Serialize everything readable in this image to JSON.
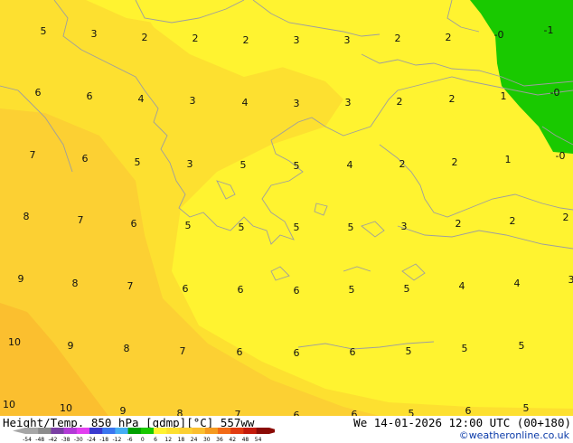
{
  "map": {
    "title": "Height/Temp. 850 hPa [gdmp][°C] 557ww",
    "datetime": "We 14-01-2026 12:00 UTC (00+180)",
    "credit": "©weatheronline.co.uk",
    "colors": {
      "warm_orange": "#fbbf2f",
      "orange": "#fcd033",
      "yellow_orange": "#fde030",
      "yellow": "#fff330",
      "green": "#19c900",
      "coastline": "#9e9e9e"
    },
    "labels": [
      [
        "5",
        48,
        38
      ],
      [
        "3",
        104,
        41
      ],
      [
        "2",
        160,
        45
      ],
      [
        "2",
        216,
        46
      ],
      [
        "2",
        272,
        48
      ],
      [
        "3",
        328,
        48
      ],
      [
        "3",
        384,
        48
      ],
      [
        "2",
        440,
        46
      ],
      [
        "2",
        496,
        45
      ],
      [
        "-0",
        552,
        42
      ],
      [
        "-1",
        607,
        37
      ],
      [
        "6",
        42,
        106
      ],
      [
        "6",
        99,
        110
      ],
      [
        "4",
        156,
        113
      ],
      [
        "3",
        213,
        115
      ],
      [
        "4",
        271,
        117
      ],
      [
        "3",
        328,
        118
      ],
      [
        "3",
        385,
        117
      ],
      [
        "2",
        442,
        116
      ],
      [
        "2",
        500,
        113
      ],
      [
        "1",
        557,
        110
      ],
      [
        "-0",
        614,
        106
      ],
      [
        "7",
        36,
        175
      ],
      [
        "6",
        94,
        179
      ],
      [
        "5",
        152,
        183
      ],
      [
        "3",
        210,
        185
      ],
      [
        "5",
        269,
        186
      ],
      [
        "5",
        328,
        187
      ],
      [
        "4",
        387,
        186
      ],
      [
        "2",
        445,
        185
      ],
      [
        "2",
        503,
        183
      ],
      [
        "1",
        562,
        180
      ],
      [
        "-0",
        620,
        176
      ],
      [
        "8",
        29,
        243
      ],
      [
        "7",
        89,
        247
      ],
      [
        "6",
        148,
        251
      ],
      [
        "5",
        208,
        253
      ],
      [
        "5",
        267,
        255
      ],
      [
        "5",
        328,
        255
      ],
      [
        "5",
        388,
        255
      ],
      [
        "3",
        447,
        254
      ],
      [
        "2",
        507,
        251
      ],
      [
        "2",
        567,
        248
      ],
      [
        "2",
        626,
        244
      ],
      [
        "9",
        23,
        312
      ],
      [
        "8",
        83,
        317
      ],
      [
        "7",
        144,
        320
      ],
      [
        "6",
        205,
        323
      ],
      [
        "6",
        266,
        324
      ],
      [
        "6",
        328,
        325
      ],
      [
        "5",
        389,
        324
      ],
      [
        "5",
        450,
        323
      ],
      [
        "4",
        511,
        320
      ],
      [
        "4",
        572,
        317
      ],
      [
        "3",
        632,
        313
      ],
      [
        "10",
        16,
        382
      ],
      [
        "9",
        78,
        386
      ],
      [
        "8",
        140,
        389
      ],
      [
        "7",
        202,
        392
      ],
      [
        "6",
        265,
        393
      ],
      [
        "6",
        328,
        394
      ],
      [
        "6",
        390,
        393
      ],
      [
        "5",
        452,
        392
      ],
      [
        "5",
        514,
        389
      ],
      [
        "5",
        577,
        386
      ],
      [
        "10",
        10,
        451
      ],
      [
        "10",
        73,
        455
      ],
      [
        "9",
        136,
        458
      ],
      [
        "8",
        199,
        461
      ],
      [
        "7",
        263,
        462
      ],
      [
        "6",
        328,
        463
      ],
      [
        "6",
        392,
        462
      ],
      [
        "5",
        455,
        461
      ],
      [
        "6",
        518,
        458
      ],
      [
        "5",
        582,
        455
      ]
    ]
  },
  "scale": {
    "ticks": [
      "-54",
      "-48",
      "-42",
      "-38",
      "-30",
      "-24",
      "-18",
      "-12",
      "-6",
      "0",
      "6",
      "12",
      "18",
      "24",
      "30",
      "36",
      "42",
      "48",
      "54"
    ],
    "colors": [
      "#a6a6a6",
      "#8c8c8c",
      "#7a3fa3",
      "#b23ad6",
      "#e23ff0",
      "#3a3acf",
      "#3a76f0",
      "#45aef5",
      "#00a000",
      "#19c900",
      "#fff330",
      "#fde030",
      "#fcd033",
      "#fbbf2f",
      "#f59a1f",
      "#f26a16",
      "#e23b10",
      "#c41a0a",
      "#8a0a05"
    ]
  }
}
